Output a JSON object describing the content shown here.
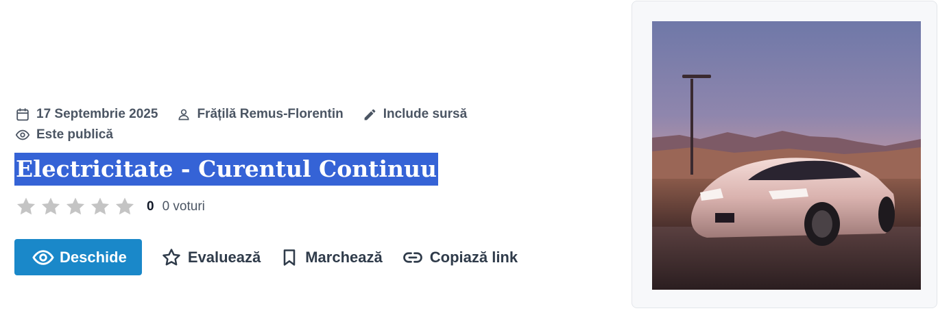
{
  "meta": {
    "date": "17 Septembrie 2025",
    "author": "Frățilă Remus-Florentin",
    "source": "Include sursă",
    "visibility": "Este publică"
  },
  "title": "Electricitate - Curentul Continuu",
  "rating": {
    "stars_filled": 0,
    "stars_total": 5,
    "count": "0",
    "votes_label": "0 voturi"
  },
  "actions": {
    "open": "Deschide",
    "rate": "Evaluează",
    "bookmark": "Marchează",
    "copy_link": "Copiază link"
  },
  "icons": [
    "calendar-icon",
    "user-icon",
    "pencil-icon",
    "eye-icon",
    "star-icon",
    "bookmark-icon",
    "link-icon"
  ],
  "colors": {
    "accent": "#1a88c9",
    "title_highlight": "#3563d6",
    "meta_text": "#4b5563",
    "star_empty": "#c4c4c4"
  }
}
